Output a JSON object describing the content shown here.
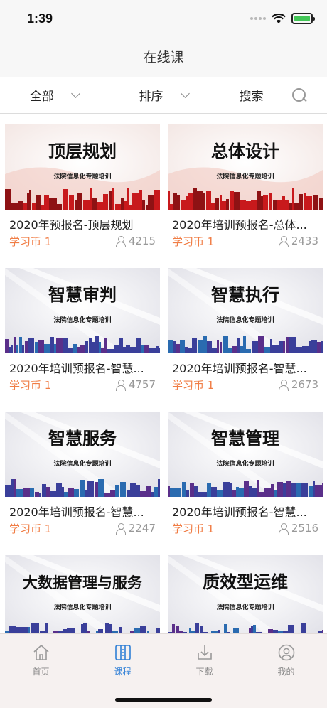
{
  "status": {
    "time": "1:39"
  },
  "nav": {
    "title": "在线课"
  },
  "filters": {
    "all_label": "全部",
    "sort_label": "排序",
    "search_label": "搜索"
  },
  "courses": [
    {
      "title": "2020年预报名-顶层规划",
      "price": "学习币 1",
      "views": "4215",
      "banner": "顶层规划",
      "subtitle": "法院信息化专题培训",
      "theme": "red"
    },
    {
      "title": "2020年培训预报名-总体...",
      "price": "学习币 1",
      "views": "2433",
      "banner": "总体设计",
      "subtitle": "法院信息化专题培训",
      "theme": "red"
    },
    {
      "title": "2020年培训预报名-智慧...",
      "price": "学习币 1",
      "views": "4757",
      "banner": "智慧审判",
      "subtitle": "法院信息化专题培训",
      "theme": "blue"
    },
    {
      "title": "2020年培训预报名-智慧...",
      "price": "学习币 1",
      "views": "2673",
      "banner": "智慧执行",
      "subtitle": "法院信息化专题培训",
      "theme": "blue"
    },
    {
      "title": "2020年培训预报名-智慧...",
      "price": "学习币 1",
      "views": "2247",
      "banner": "智慧服务",
      "subtitle": "法院信息化专题培训",
      "theme": "blue"
    },
    {
      "title": "2020年培训预报名-智慧...",
      "price": "学习币 1",
      "views": "2516",
      "banner": "智慧管理",
      "subtitle": "法院信息化专题培训",
      "theme": "blue"
    },
    {
      "title": "",
      "price": "",
      "views": "",
      "banner": "大数据管理与服务",
      "subtitle": "法院信息化专题培训",
      "theme": "blue"
    },
    {
      "title": "",
      "price": "",
      "views": "",
      "banner": "质效型运维",
      "subtitle": "法院信息化专题培训",
      "theme": "blue"
    }
  ],
  "tabs": [
    {
      "label": "首页",
      "icon": "home-icon",
      "active": false
    },
    {
      "label": "课程",
      "icon": "course-icon",
      "active": true
    },
    {
      "label": "下载",
      "icon": "download-icon",
      "active": false
    },
    {
      "label": "我的",
      "icon": "profile-icon",
      "active": false
    }
  ],
  "colors": {
    "accent": "#2f7fd6",
    "price": "#f07d45",
    "red_skyline": "#c8191c",
    "blue_skyline": "#3a3f9a"
  }
}
